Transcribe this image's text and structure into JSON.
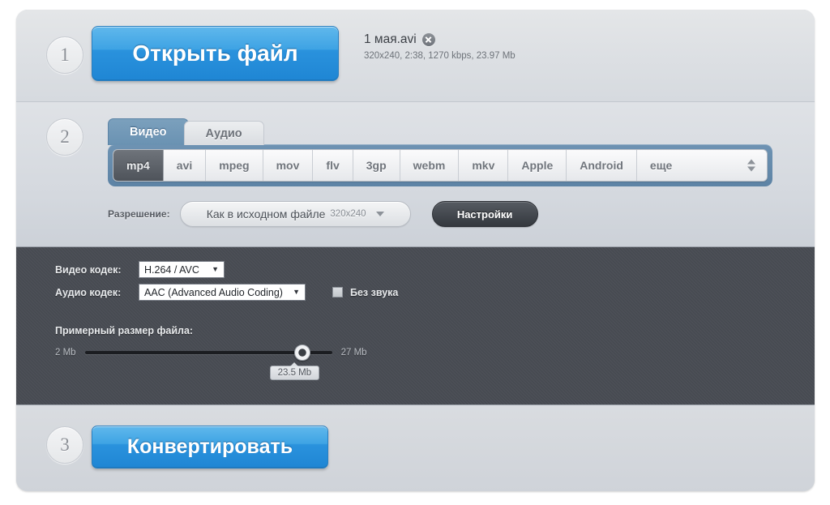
{
  "steps": {
    "one": "1",
    "two": "2",
    "three": "3"
  },
  "open_section": {
    "button_label": "Открыть файл",
    "file_name": "1 мая.avi",
    "file_meta": "320x240, 2:38, 1270 kbps, 23.97 Mb",
    "remove_icon": "close-circle-icon"
  },
  "settings_section": {
    "tabs": [
      {
        "label": "Видео",
        "active": true
      },
      {
        "label": "Аудио",
        "active": false
      }
    ],
    "formats": [
      {
        "label": "mp4",
        "selected": true
      },
      {
        "label": "avi",
        "selected": false
      },
      {
        "label": "mpeg",
        "selected": false
      },
      {
        "label": "mov",
        "selected": false
      },
      {
        "label": "flv",
        "selected": false
      },
      {
        "label": "3gp",
        "selected": false
      },
      {
        "label": "webm",
        "selected": false
      },
      {
        "label": "mkv",
        "selected": false
      },
      {
        "label": "Apple",
        "selected": false
      },
      {
        "label": "Android",
        "selected": false
      },
      {
        "label": "еще",
        "selected": false
      }
    ],
    "more_spinner_icon": "up-down-arrows-icon",
    "resolution_label": "Разрешение:",
    "resolution_value": "Как в исходном файле",
    "resolution_sub": "320x240",
    "resolution_caret_icon": "chevron-down-icon",
    "settings_button_label": "Настройки"
  },
  "codec_section": {
    "video_codec_label": "Видео кодек:",
    "video_codec_value": "H.264 / AVC",
    "audio_codec_label": "Аудио кодек:",
    "audio_codec_value": "AAC (Advanced Audio Coding)",
    "select_caret": "▼",
    "mute_label": "Без звука",
    "mute_checked": false,
    "filesize_title": "Примерный размер файла:",
    "slider_min": "2 Mb",
    "slider_max": "27 Mb",
    "slider_value": "23.5 Mb"
  },
  "convert_section": {
    "button_label": "Конвертировать"
  },
  "colors": {
    "accent_blue": "#2a92dd",
    "tab_active": "#6a92b2",
    "format_bar": "#5d83a5",
    "dark_panel": "#464a51",
    "selected_format": "#4e535a"
  }
}
